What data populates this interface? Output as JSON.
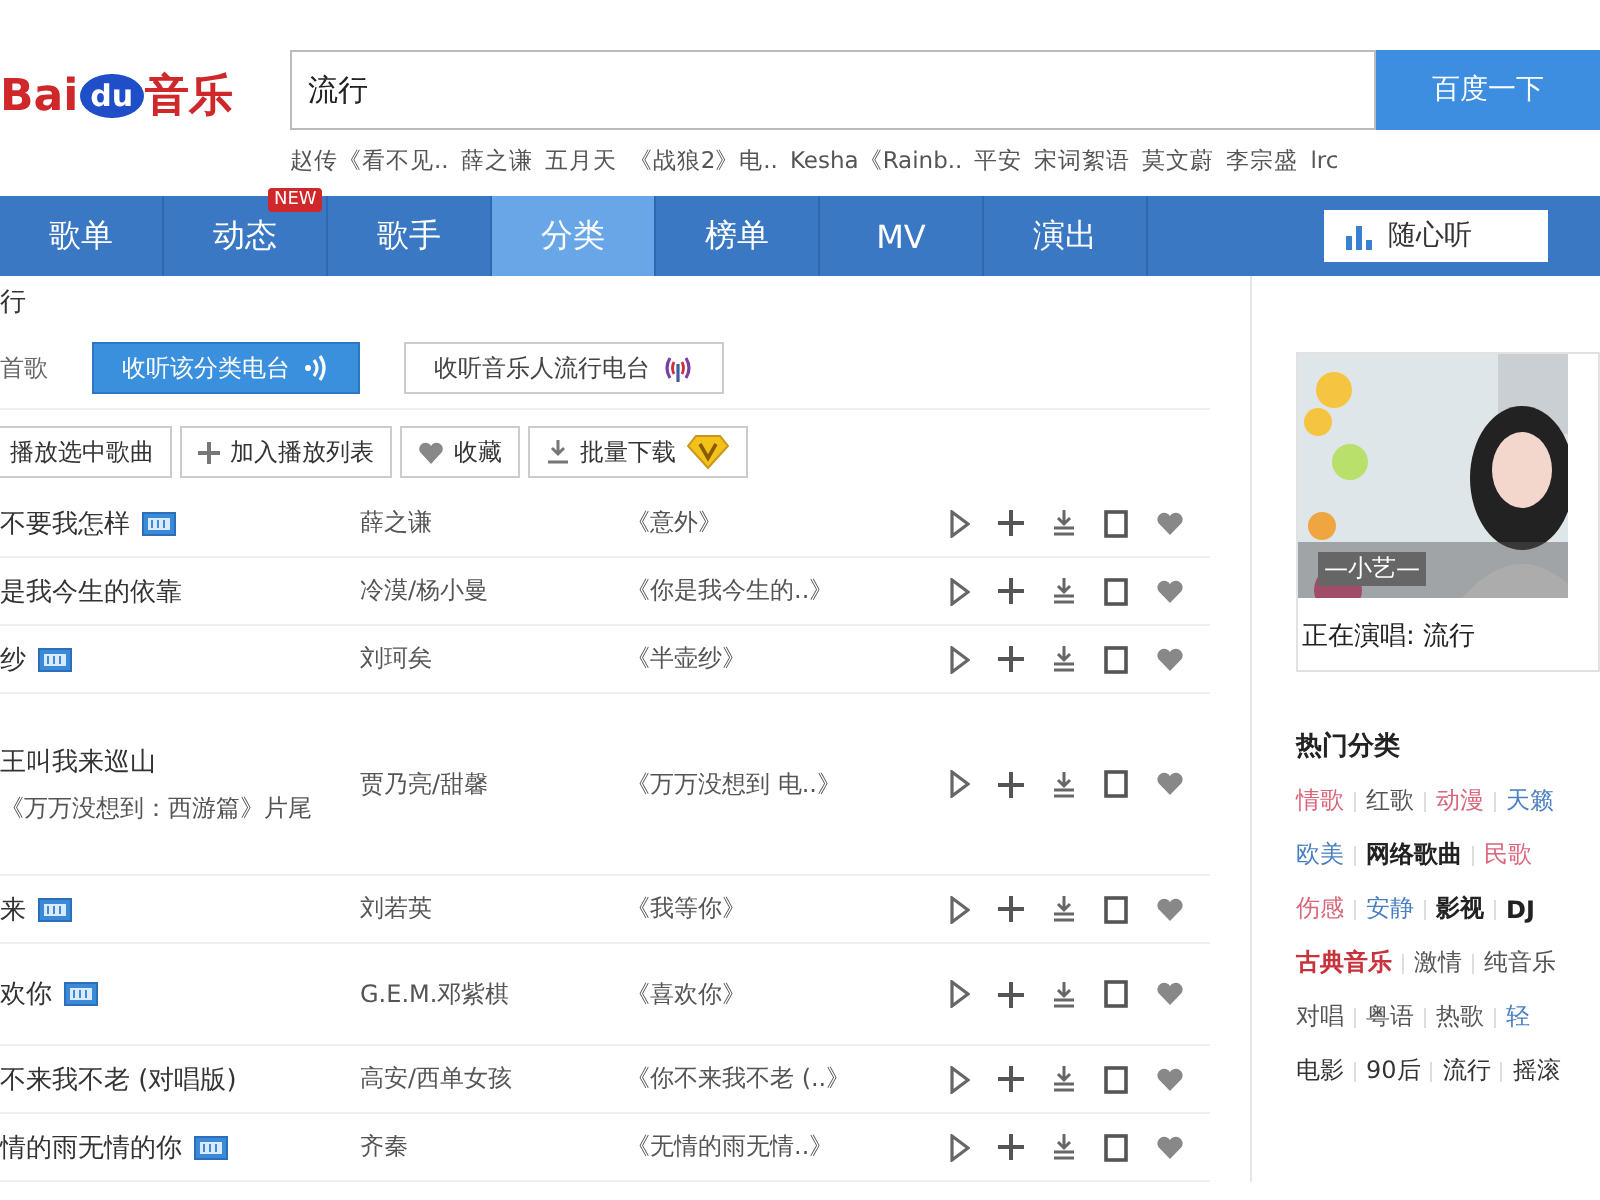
{
  "logo": {
    "text": "Bai",
    "badge": "du",
    "suffix": "音乐"
  },
  "search": {
    "value": "流行",
    "button": "百度一下"
  },
  "hot_searches": [
    "赵传《看不见..",
    "薛之谦",
    "五月天",
    "《战狼2》电..",
    "Kesha《Rainb..",
    "平安",
    "宋词絮语",
    "莫文蔚",
    "李宗盛",
    "lrc"
  ],
  "nav": {
    "tabs": [
      {
        "label": "歌单",
        "selected": false
      },
      {
        "label": "动态",
        "selected": false,
        "badge": "NEW"
      },
      {
        "label": "歌手",
        "selected": false
      },
      {
        "label": "分类",
        "selected": true
      },
      {
        "label": "榜单",
        "selected": false
      },
      {
        "label": "MV",
        "selected": false
      },
      {
        "label": "演出",
        "selected": false
      }
    ],
    "radio_button": "随心听"
  },
  "breadcrumb": "行",
  "count_label": "首歌",
  "radio_buttons": [
    {
      "label": "收听该分类电台",
      "primary": true
    },
    {
      "label": "收听音乐人流行电台",
      "primary": false
    }
  ],
  "toolbar": [
    {
      "label": "播放选中歌曲",
      "kind": "plain"
    },
    {
      "label": "加入播放列表",
      "kind": "add"
    },
    {
      "label": "收藏",
      "kind": "heart"
    },
    {
      "label": "批量下载",
      "kind": "download"
    }
  ],
  "songs": [
    {
      "title": "不要我怎样",
      "mv": true,
      "artist": "薛之谦",
      "album": "《意外》"
    },
    {
      "title": "是我今生的依靠",
      "mv": false,
      "artist": "冷漠/杨小曼",
      "album": "《你是我今生的..》"
    },
    {
      "title": "纱",
      "mv": true,
      "artist": "刘珂矣",
      "album": "《半壶纱》"
    },
    {
      "title": "王叫我来巡山",
      "subtitle": "《万万没想到：西游篇》片尾",
      "mv": false,
      "artist": "贾乃亮/甜馨",
      "album": "《万万没想到 电..》"
    },
    {
      "title": "来",
      "mv": true,
      "artist": "刘若英",
      "album": "《我等你》"
    },
    {
      "title": "欢你",
      "mv": true,
      "artist": "G.E.M.邓紫棋",
      "album": "《喜欢你》"
    },
    {
      "title": "不来我不老 (对唱版)",
      "mv": false,
      "artist": "高安/西单女孩",
      "album": "《你不来我不老 (..》"
    },
    {
      "title": "情的雨无情的你",
      "mv": true,
      "artist": "齐秦",
      "album": "《无情的雨无情..》"
    }
  ],
  "singer_card": {
    "photo_caption": "—小艺—",
    "now_singing": "正在演唱: 流行"
  },
  "hot_categories": {
    "title": "热门分类",
    "rows": [
      [
        {
          "label": "情歌",
          "color": "#d9667a"
        },
        {
          "label": "红歌",
          "color": "#555555"
        },
        {
          "label": "动漫",
          "color": "#d9667a"
        },
        {
          "label": "天籁",
          "color": "#4a7fc1"
        }
      ],
      [
        {
          "label": "欧美",
          "color": "#4a7fc1"
        },
        {
          "label": "网络歌曲",
          "color": "#222222",
          "bold": true
        },
        {
          "label": "民歌",
          "color": "#d9667a"
        }
      ],
      [
        {
          "label": "伤感",
          "color": "#d9667a"
        },
        {
          "label": "安静",
          "color": "#4a7fc1"
        },
        {
          "label": "影视",
          "color": "#222222",
          "bold": true
        },
        {
          "label": "DJ",
          "color": "#222222",
          "bold": true
        }
      ],
      [
        {
          "label": "古典音乐",
          "color": "#c8323c",
          "bold": true
        },
        {
          "label": "激情",
          "color": "#555555"
        },
        {
          "label": "纯音乐",
          "color": "#555555"
        }
      ],
      [
        {
          "label": "对唱",
          "color": "#555555"
        },
        {
          "label": "粤语",
          "color": "#555555"
        },
        {
          "label": "热歌",
          "color": "#555555"
        },
        {
          "label": "轻",
          "color": "#4a7fc1"
        }
      ],
      [
        {
          "label": "电影",
          "color": "#333333"
        },
        {
          "label": "90后",
          "color": "#333333"
        },
        {
          "label": "流行",
          "color": "#333333"
        },
        {
          "label": "摇滚",
          "color": "#333333"
        }
      ]
    ]
  }
}
